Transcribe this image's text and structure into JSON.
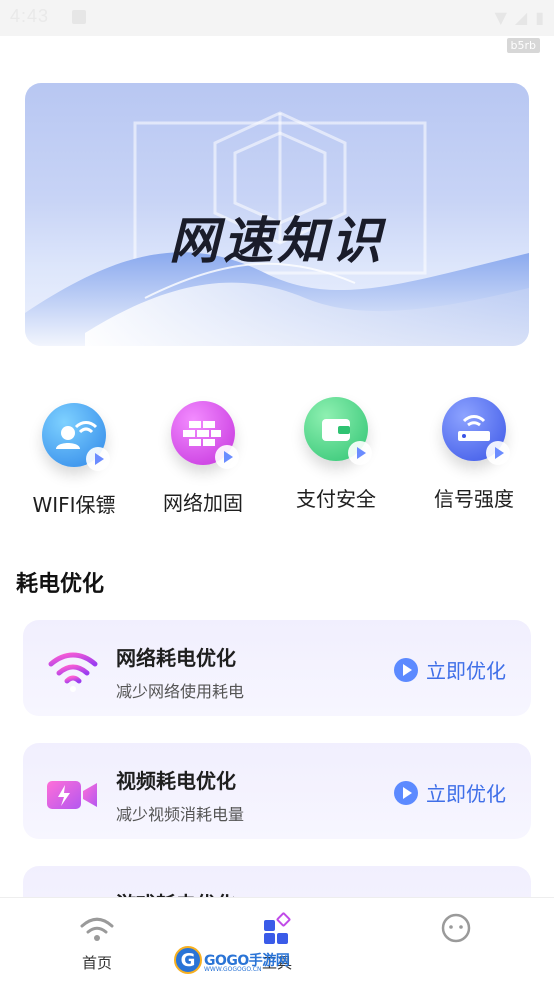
{
  "status_bar": {
    "time": "4:43"
  },
  "build_tag": "b5rb",
  "banner": {
    "title": "网速知识"
  },
  "features": [
    {
      "label": "WIFI保镖",
      "icon": "wifi-user-icon",
      "color": "#3c9bf0"
    },
    {
      "label": "网络加固",
      "icon": "firewall-icon",
      "color": "#d44ce8"
    },
    {
      "label": "支付安全",
      "icon": "wallet-icon",
      "color": "#3fcf7e"
    },
    {
      "label": "信号强度",
      "icon": "router-icon",
      "color": "#5a6ff5"
    }
  ],
  "section": {
    "title": "耗电优化"
  },
  "optimizations": [
    {
      "title": "网络耗电优化",
      "subtitle": "减少网络使用耗电",
      "action": "立即优化",
      "icon": "wifi-icon"
    },
    {
      "title": "视频耗电优化",
      "subtitle": "减少视频消耗电量",
      "action": "立即优化",
      "icon": "video-icon"
    },
    {
      "title": "游戏耗电优化",
      "subtitle": "",
      "action": "",
      "icon": "game-icon"
    }
  ],
  "bottom_nav": [
    {
      "label": "首页",
      "icon": "wifi-home-icon"
    },
    {
      "label": "工具",
      "icon": "tools-grid-icon"
    },
    {
      "label": "",
      "icon": "smiley-icon"
    }
  ],
  "watermark": {
    "text": "GOGO手游网",
    "sub": "WWW.GOGOGO.CN"
  },
  "colors": {
    "accent": "#3f6fe8",
    "card_bg": "#f3f1fe"
  }
}
